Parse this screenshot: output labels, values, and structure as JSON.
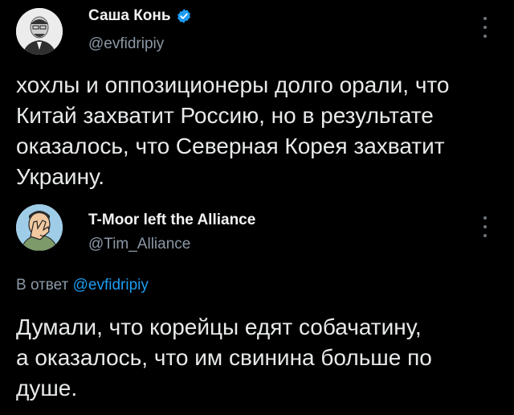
{
  "tweet": {
    "author_name": "Саша Конь",
    "author_handle": "@evfidripiy",
    "verified": true,
    "text_lines": [
      "хохлы и оппозиционеры долго орали, что",
      "Китай захватит Россию, но в результате",
      "оказалось, что Северная Корея захватит",
      "Украину."
    ]
  },
  "reply": {
    "author_name": "T-Moor left the Alliance",
    "author_handle": "@Tim_Alliance",
    "reply_prefix": "В ответ",
    "reply_to_handle": "@evfidripiy",
    "text_lines": [
      "Думали, что корейцы едят собачатину,",
      "а оказалось, что им свинина больше по",
      "душе."
    ]
  },
  "colors": {
    "background": "#000000",
    "text": "#e7e9ea",
    "muted": "#8b98a5",
    "link": "#1d9bf0",
    "verified": "#1d9bf0"
  },
  "icons": [
    "verified-badge-icon",
    "more-options-icon"
  ]
}
